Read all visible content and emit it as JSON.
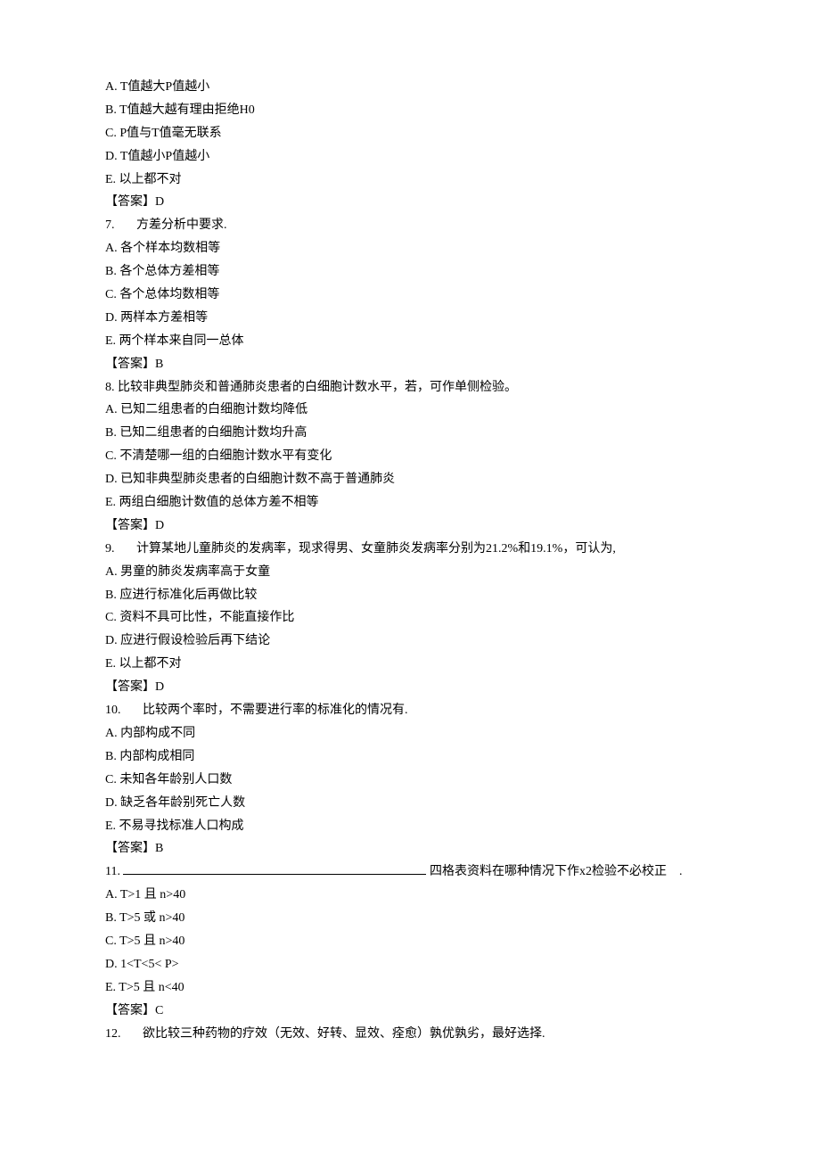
{
  "q_intro": {
    "A": "A.  T值越大P值越小",
    "B": "B.  T值越大越有理由拒绝H0",
    "C": "C.  P值与T值毫无联系",
    "D": "D.  T值越小P值越小",
    "E": "E.  以上都不对",
    "answer": "【答案】D"
  },
  "q7": {
    "num": "7.",
    "text": "方差分析中要求.",
    "A": "A.  各个样本均数相等",
    "B": "B.  各个总体方差相等",
    "C": "C.  各个总体均数相等",
    "D": "D.  两样本方差相等",
    "E": "E.  两个样本来自同一总体",
    "answer": "【答案】B"
  },
  "q8": {
    "stem": "8.  比较非典型肺炎和普通肺炎患者的白细胞计数水平，若，可作单侧检验。",
    "A": "A.  已知二组患者的白细胞计数均降低",
    "B": "B.  已知二组患者的白细胞计数均升高",
    "C": "C.  不清楚哪一组的白细胞计数水平有变化",
    "D": "D.  已知非典型肺炎患者的白细胞计数不高于普通肺炎",
    "E": "E.  两组白细胞计数值的总体方差不相等",
    "answer": "【答案】D"
  },
  "q9": {
    "num": "9.",
    "text": "计算某地儿童肺炎的发病率，现求得男、女童肺炎发病率分别为21.2%和19.1%，可认为,",
    "A": "A.  男童的肺炎发病率高于女童",
    "B": "B.  应进行标准化后再做比较",
    "C": "C.  资料不具可比性，不能直接作比",
    "D": "D.  应进行假设检验后再下结论",
    "E": "E.  以上都不对",
    "answer": "【答案】D"
  },
  "q10": {
    "num": "10.",
    "text": "比较两个率时，不需要进行率的标准化的情况有.",
    "A": "A.  内部构成不同",
    "B": "B.  内部构成相同",
    "C": "C.  未知各年龄别人口数",
    "D": "D.  缺乏各年龄别死亡人数",
    "E": "E.  不易寻找标准人口构成",
    "answer": "【答案】B"
  },
  "q11": {
    "num": "11.",
    "text_after": " 四格表资料在哪种情况下作x2检验不必校正",
    "tail": ".",
    "A": "A.  T>1 且  n>40",
    "B": "B.  T>5 或  n>40",
    "C": "C.  T>5 且  n>40",
    "D": "D.  1<T<5< P>",
    "E": "E.  T>5 且  n<40",
    "answer": "【答案】C"
  },
  "q12": {
    "num": "12.",
    "text": "欲比较三种药物的疗效（无效、好转、显效、痊愈）孰优孰劣，最好选择."
  }
}
